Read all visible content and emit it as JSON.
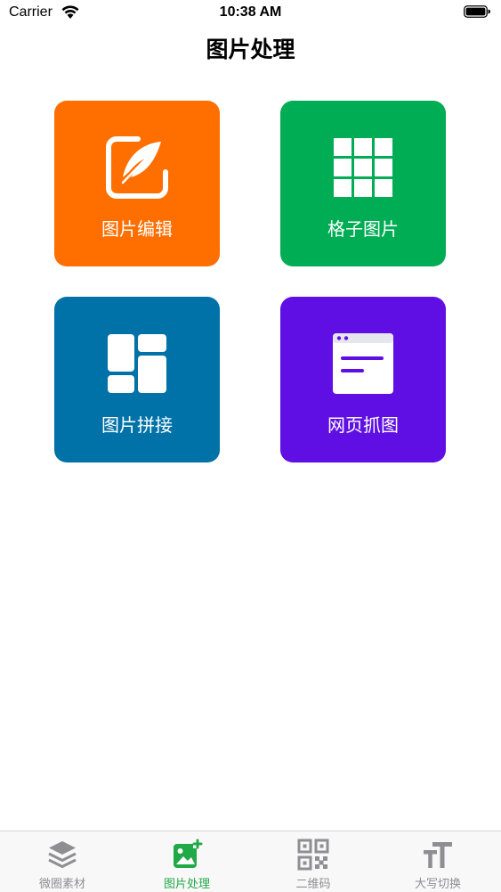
{
  "status_bar": {
    "carrier": "Carrier",
    "time": "10:38 AM"
  },
  "nav": {
    "title": "图片处理"
  },
  "tiles": [
    {
      "label": "图片编辑",
      "color": "#ff6f00",
      "icon": "edit-feather-icon"
    },
    {
      "label": "格子图片",
      "color": "#00ad54",
      "icon": "grid-icon"
    },
    {
      "label": "图片拼接",
      "color": "#0072a8",
      "icon": "collage-layout-icon"
    },
    {
      "label": "网页抓图",
      "color": "#5f0fe4",
      "icon": "webpage-icon"
    }
  ],
  "tab_bar": {
    "active_color": "#21a947",
    "inactive_color": "#8e8e93",
    "items": [
      {
        "label": "微圈素材",
        "icon": "layers-icon",
        "active": false
      },
      {
        "label": "图片处理",
        "icon": "image-add-icon",
        "active": true
      },
      {
        "label": "二维码",
        "icon": "qr-code-icon",
        "active": false
      },
      {
        "label": "大写切换",
        "icon": "text-size-icon",
        "active": false
      }
    ]
  }
}
